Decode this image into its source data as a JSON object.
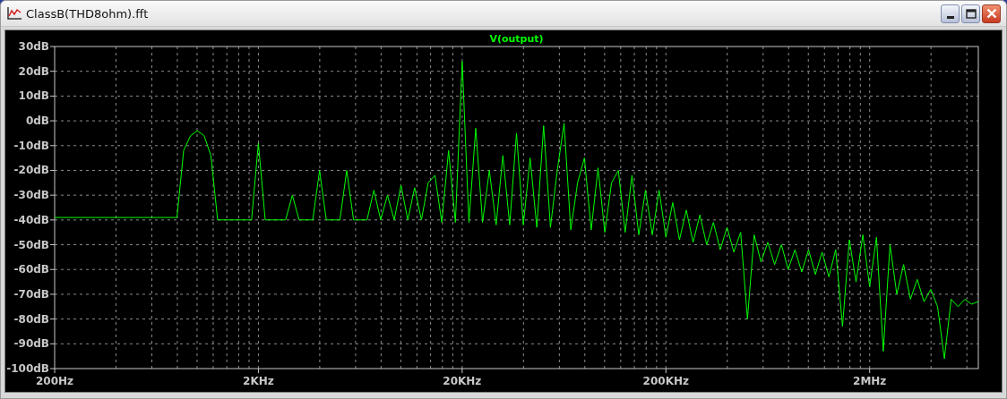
{
  "window": {
    "title": "ClassB(THD8ohm).fft"
  },
  "plot": {
    "chart_data": {
      "type": "line",
      "grid": true,
      "ylim": [
        -100,
        30
      ],
      "yticks": [
        {
          "value": 30,
          "label": "30dB"
        },
        {
          "value": 20,
          "label": "20dB"
        },
        {
          "value": 10,
          "label": "10dB"
        },
        {
          "value": 0,
          "label": "0dB"
        },
        {
          "value": -10,
          "label": "-10dB"
        },
        {
          "value": -20,
          "label": "-20dB"
        },
        {
          "value": -30,
          "label": "-30dB"
        },
        {
          "value": -40,
          "label": "-40dB"
        },
        {
          "value": -50,
          "label": "-50dB"
        },
        {
          "value": -60,
          "label": "-60dB"
        },
        {
          "value": -70,
          "label": "-70dB"
        },
        {
          "value": -80,
          "label": "-80dB"
        },
        {
          "value": -90,
          "label": "-90dB"
        },
        {
          "value": -100,
          "label": "-100dB"
        }
      ],
      "categories": [
        "200Hz",
        null,
        null,
        null,
        null,
        null,
        null,
        null,
        null,
        null,
        null,
        null,
        null,
        null,
        null,
        null,
        null,
        null,
        null,
        null,
        null,
        null,
        null,
        null,
        null,
        null,
        null,
        null,
        null,
        null,
        "2KHz",
        null,
        null,
        null,
        null,
        null,
        null,
        null,
        null,
        null,
        null,
        null,
        null,
        null,
        null,
        null,
        null,
        null,
        null,
        null,
        null,
        null,
        null,
        null,
        null,
        null,
        null,
        null,
        null,
        null,
        "20KHz",
        null,
        null,
        null,
        null,
        null,
        null,
        null,
        null,
        null,
        null,
        null,
        null,
        null,
        null,
        null,
        null,
        null,
        null,
        null,
        null,
        null,
        null,
        null,
        null,
        null,
        null,
        null,
        null,
        null,
        "200KHz",
        null,
        null,
        null,
        null,
        null,
        null,
        null,
        null,
        null,
        null,
        null,
        null,
        null,
        null,
        null,
        null,
        null,
        null,
        null,
        null,
        null,
        null,
        null,
        null,
        null,
        null,
        null,
        null,
        null,
        "2MHz",
        null,
        null,
        null,
        null,
        null,
        null,
        null,
        null,
        null,
        null,
        null,
        null,
        null,
        null,
        null,
        null
      ],
      "series": [
        {
          "name": "V(output)",
          "color": "#00ff00",
          "values": [
            -39,
            -39,
            -39,
            -39,
            -39,
            -39,
            -39,
            -39,
            -39,
            -39,
            -39,
            -39,
            -39,
            -39,
            -39,
            -39,
            -39,
            -39,
            -39,
            -12,
            -6,
            -4,
            -6,
            -14,
            -40,
            -40,
            -40,
            -40,
            -40,
            -40,
            -9,
            -40,
            -40,
            -40,
            -40,
            -30,
            -40,
            -40,
            -40,
            -20,
            -40,
            -40,
            -40,
            -20,
            -40,
            -40,
            -40,
            -28,
            -40,
            -30,
            -40,
            -26,
            -40,
            -27,
            -40,
            -25,
            -22,
            -41,
            -12,
            -41,
            24,
            -41,
            -3,
            -41,
            -20,
            -42,
            -14,
            -42,
            -5,
            -42,
            -15,
            -43,
            -2,
            -43,
            -20,
            -1,
            -44,
            -25,
            -15,
            -44,
            -19,
            -45,
            -25,
            -20,
            -45,
            -22,
            -46,
            -28,
            -46,
            -28,
            -47,
            -33,
            -48,
            -36,
            -49,
            -38,
            -50,
            -41,
            -52,
            -43,
            -53,
            -45,
            -80,
            -46,
            -57,
            -49,
            -58,
            -50,
            -60,
            -52,
            -61,
            -52,
            -62,
            -53,
            -63,
            -52,
            -83,
            -48,
            -65,
            -46,
            -67,
            -47,
            -93,
            -50,
            -70,
            -58,
            -72,
            -64,
            -73,
            -68,
            -75,
            -96,
            -72,
            -75,
            -72,
            -74,
            -73
          ]
        }
      ]
    }
  }
}
